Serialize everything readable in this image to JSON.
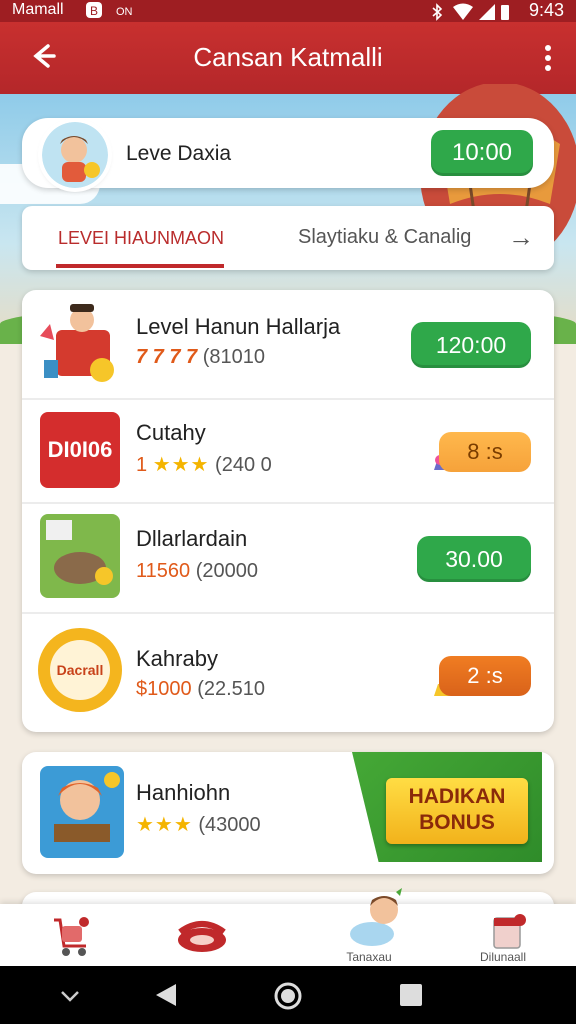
{
  "status_bar": {
    "carrier": "Mamall",
    "time": "9:43"
  },
  "header": {
    "title": "Cansan Katmalli"
  },
  "profile": {
    "name": "Leve Daxia",
    "time_value": "10:00"
  },
  "tabs": {
    "active": "LEVEI HIAUNMAON",
    "inactive": "Slaytiaku & Canalig"
  },
  "items": [
    {
      "title": "Level Hanun Hallarja",
      "rating": "7 7 7 7",
      "count": "(81010",
      "action": "120:00",
      "badge_text": ""
    },
    {
      "title": "Cutahy",
      "rating": "1",
      "count": "(240 0",
      "action": "8 :s",
      "badge_text": "DI0I06"
    },
    {
      "title": "Dllarlardain",
      "rating": "11560",
      "count": "(20000",
      "action": "30.00",
      "badge_text": ""
    },
    {
      "title": "Kahraby",
      "rating": "$1000",
      "count": "(22.510",
      "action": "2 :s",
      "badge_text": "Dacrall"
    }
  ],
  "bonus_item": {
    "title": "Hanhiohn",
    "count": "(43000",
    "bonus_line1": "HADIKAN",
    "bonus_line2": "BONUS"
  },
  "bottom_nav": {
    "item3_label": "Tanaxau",
    "item4_label": "Dilunaall"
  },
  "colors": {
    "header_red": "#c0292b",
    "green": "#2fa84a",
    "orange": "#f6a23a",
    "star": "#f4b400"
  }
}
